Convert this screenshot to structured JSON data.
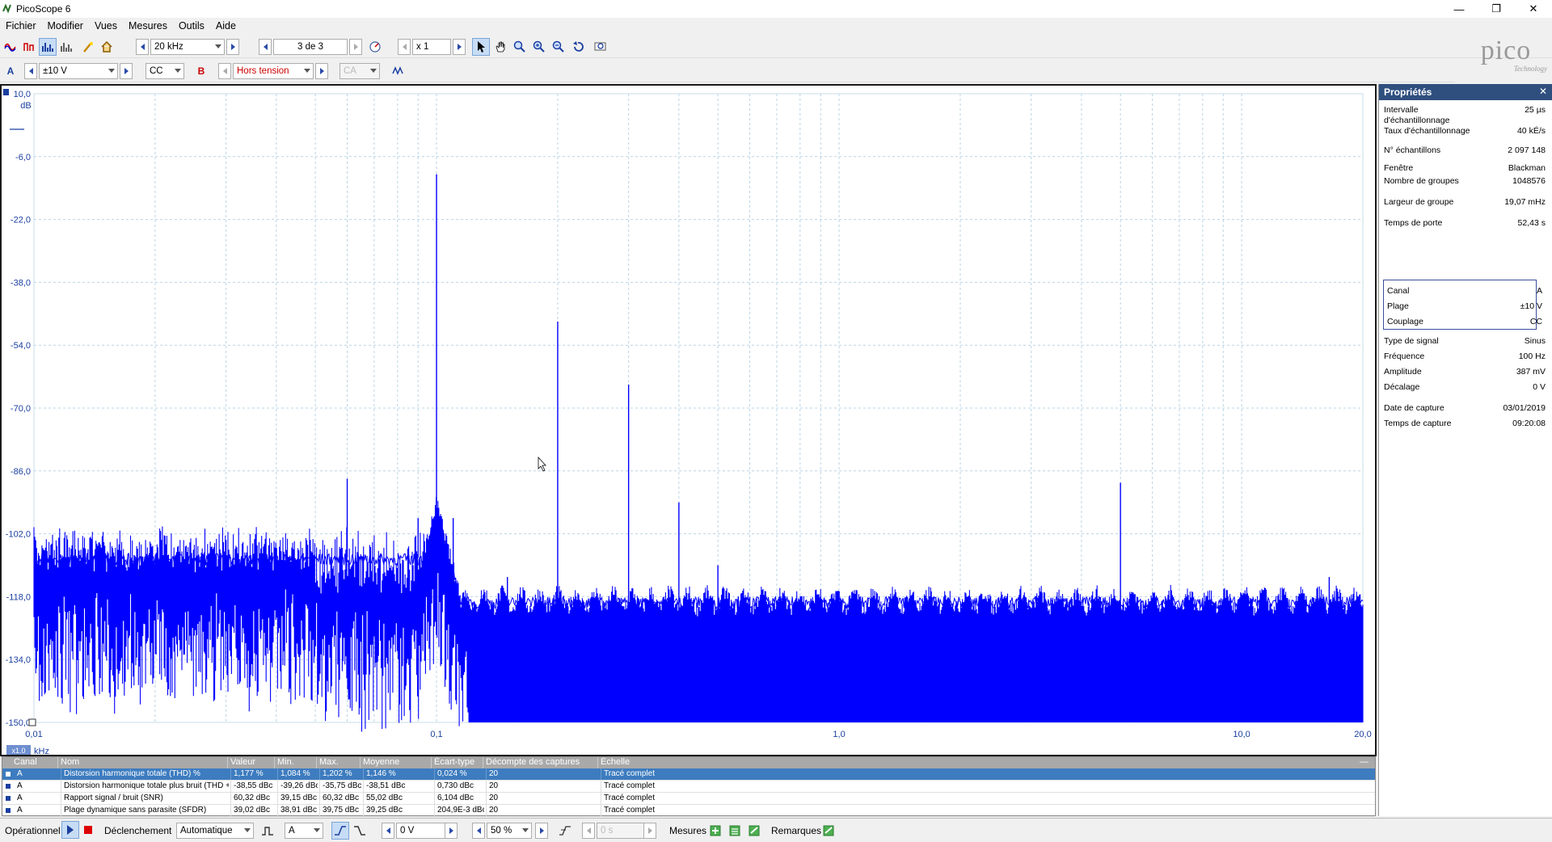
{
  "window": {
    "title": "PicoScope 6",
    "minimize": "—",
    "restore": "❐",
    "close": "✕"
  },
  "menu": [
    "Fichier",
    "Modifier",
    "Vues",
    "Mesures",
    "Outils",
    "Aide"
  ],
  "toolbar1": {
    "frequency_range": "20 kHz",
    "capture_index": "3 de 3",
    "zoom_factor": "x 1"
  },
  "toolbar2": {
    "channel_a_label": "A",
    "channel_a_range": "±10 V",
    "channel_a_coupling": "CC",
    "channel_b_label": "B",
    "channel_b_range": "Hors tension",
    "channel_b_coupling": "CA"
  },
  "logo": {
    "text": "pico",
    "subtext": "Technology"
  },
  "chart_data": {
    "type": "line",
    "title": "",
    "xlabel": "kHz",
    "ylabel": "dB",
    "x_scale": "log",
    "xlim": [
      0.01,
      20.0
    ],
    "ylim": [
      -150,
      10
    ],
    "x_ticks": [
      "0,01",
      "0,1",
      "1,0",
      "10,0",
      "20,0"
    ],
    "y_ticks": [
      "10,0",
      "-6,0",
      "-22,0",
      "-38,0",
      "-54,0",
      "-70,0",
      "-86,0",
      "-102,0",
      "-118,0",
      "-134,0",
      "-150,0"
    ],
    "x_scale_badge": "x1.0",
    "grid": true,
    "series": [
      {
        "color": "#0000ff",
        "peaks": [
          {
            "x": 0.1,
            "y": -10.5
          },
          {
            "x": 0.2,
            "y": -48
          },
          {
            "x": 0.3,
            "y": -64
          },
          {
            "x": 0.4,
            "y": -94
          },
          {
            "x": 0.5,
            "y": -110
          },
          {
            "x": 0.6,
            "y": -118
          },
          {
            "x": 0.7,
            "y": -119
          },
          {
            "x": 0.8,
            "y": -119
          },
          {
            "x": 0.9,
            "y": -118
          },
          {
            "x": 1.1,
            "y": -120
          },
          {
            "x": 1.2,
            "y": -119
          },
          {
            "x": 0.06,
            "y": -88
          },
          {
            "x": 0.15,
            "y": -113
          },
          {
            "x": 5.0,
            "y": -89
          },
          {
            "x": 16.5,
            "y": -113
          },
          {
            "x": 0.09,
            "y": -98
          },
          {
            "x": 0.11,
            "y": -98
          }
        ],
        "noise_floor_low": -108,
        "noise_floor_high": -125
      }
    ]
  },
  "properties": {
    "title": "Propriétés",
    "rows": [
      {
        "key": "Intervalle d'échantillonnage",
        "value": "25 µs"
      },
      {
        "key": "Taux d'échantillonnage",
        "value": "40 kÉ/s"
      },
      {
        "key": "N° échantillons",
        "value": "2 097 148"
      },
      {
        "key": "Fenêtre",
        "value": "Blackman"
      },
      {
        "key": "Nombre de groupes",
        "value": "1048576"
      },
      {
        "key": "Largeur de groupe",
        "value": "19,07 mHz"
      },
      {
        "key": "Temps de porte",
        "value": "52,43 s"
      }
    ],
    "channel": [
      {
        "key": "Canal",
        "value": "A"
      },
      {
        "key": "Plage",
        "value": "±10 V"
      },
      {
        "key": "Couplage",
        "value": "CC"
      }
    ],
    "signal": [
      {
        "key": "Type de signal",
        "value": "Sinus"
      },
      {
        "key": "Fréquence",
        "value": "100 Hz"
      },
      {
        "key": "Amplitude",
        "value": "387 mV"
      },
      {
        "key": "Décalage",
        "value": "0 V"
      }
    ],
    "capture": [
      {
        "key": "Date de capture",
        "value": "03/01/2019"
      },
      {
        "key": "Temps de capture",
        "value": "09:20:08"
      }
    ]
  },
  "measurements": {
    "headers": [
      "Canal",
      "Nom",
      "Valeur",
      "Min.",
      "Max.",
      "Moyenne",
      "Écart-type",
      "Décompte des captures",
      "Échelle"
    ],
    "collapse": "—",
    "rows": [
      [
        "A",
        "Distorsion harmonique totale (THD) %",
        "1,177 %",
        "1,084 %",
        "1,202 %",
        "1,146 %",
        "0,024 %",
        "20",
        "Tracé complet"
      ],
      [
        "A",
        "Distorsion harmonique totale plus bruit (THD + N)",
        "-38,55 dBc",
        "-39,26 dBc",
        "-35,75 dBc",
        "-38,51 dBc",
        "0,730 dBc",
        "20",
        "Tracé complet"
      ],
      [
        "A",
        "Rapport signal / bruit (SNR)",
        "60,32 dBc",
        "39,15 dBc",
        "60,32 dBc",
        "55,02 dBc",
        "6,104 dBc",
        "20",
        "Tracé complet"
      ],
      [
        "A",
        "Plage dynamique sans parasite (SFDR)",
        "39,02 dBc",
        "38,91 dBc",
        "39,75 dBc",
        "39,25 dBc",
        "204,9E-3 dBc",
        "20",
        "Tracé complet"
      ]
    ]
  },
  "bottombar": {
    "status": "Opérationnel",
    "trigger_label": "Déclenchement",
    "trigger_mode": "Automatique",
    "trigger_channel": "A",
    "trigger_level": "0 V",
    "pretrigger": "50 %",
    "delay": "0 s",
    "measures_label": "Mesures",
    "notes_label": "Remarques"
  }
}
